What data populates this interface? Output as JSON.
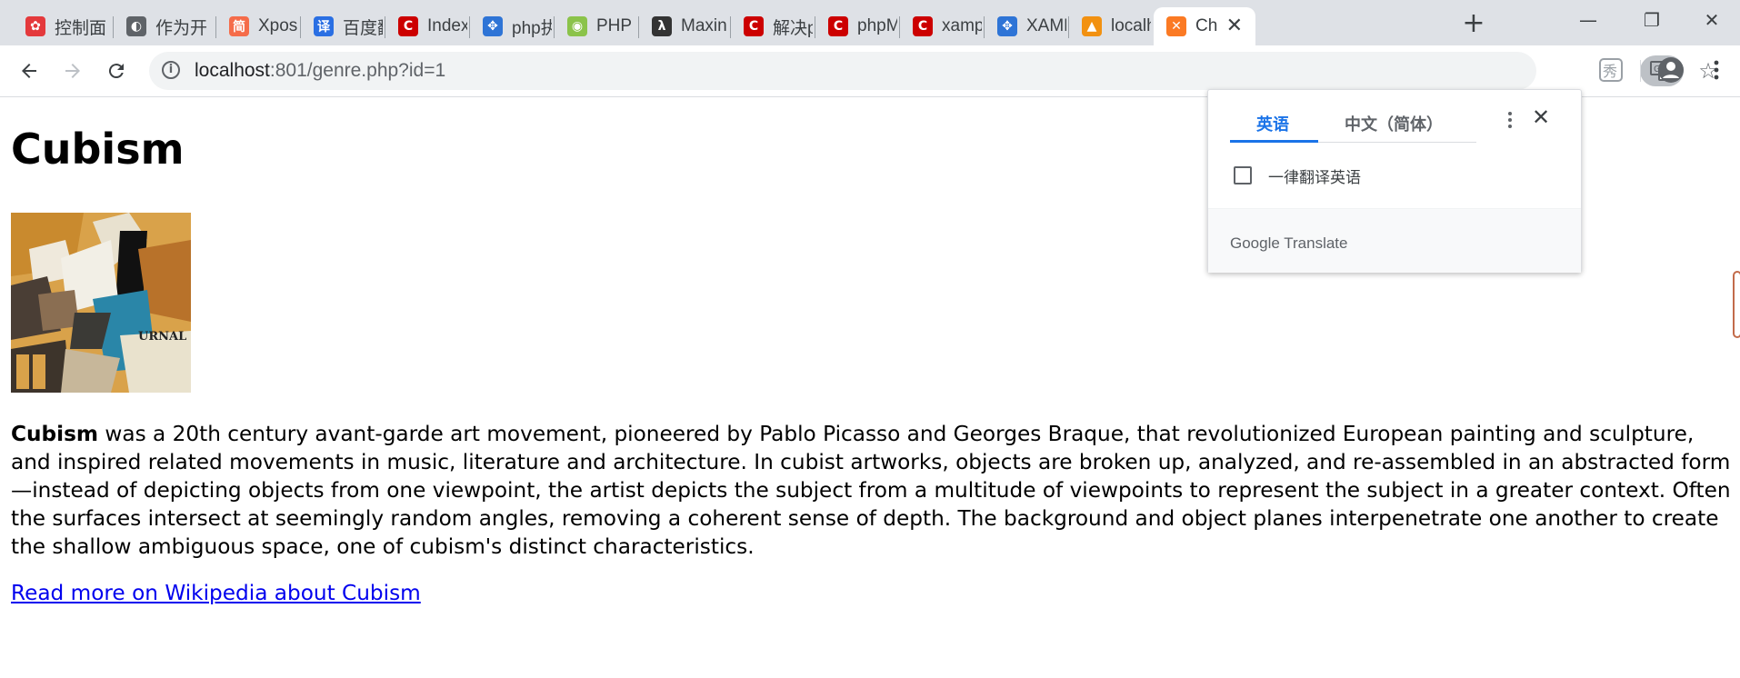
{
  "browser": {
    "tabs": [
      {
        "title": "控制面",
        "favicon": "huawei-icon",
        "color": "#e4393c"
      },
      {
        "title": "作为开",
        "favicon": "globe-icon",
        "color": "#5f6368"
      },
      {
        "title": "Xpose",
        "favicon": "jian-icon",
        "color": "#f56c4a"
      },
      {
        "title": "百度翻",
        "favicon": "translate-yi-icon",
        "color": "#2a6fe3"
      },
      {
        "title": "Index",
        "favicon": "csdn-icon",
        "color": "#c00"
      },
      {
        "title": "php执",
        "favicon": "baidu-paw-icon",
        "color": "#2e74d6"
      },
      {
        "title": "PHP $",
        "favicon": "php-icon",
        "color": "#8bc34a"
      },
      {
        "title": "Maxin",
        "favicon": "maxin-icon",
        "color": "#333"
      },
      {
        "title": "解决pl",
        "favicon": "csdn-icon",
        "color": "#c00"
      },
      {
        "title": "phpM",
        "favicon": "csdn-icon",
        "color": "#c00"
      },
      {
        "title": "xampp",
        "favicon": "csdn-icon",
        "color": "#c00"
      },
      {
        "title": "XAMP",
        "favicon": "baidu-paw-icon",
        "color": "#2e74d6"
      },
      {
        "title": "localh",
        "favicon": "phpmyadmin-icon",
        "color": "#f29111"
      },
      {
        "title": "Ch",
        "favicon": "xampp-icon",
        "color": "#fb7a24",
        "active": true
      }
    ],
    "new_tab_label": "+",
    "address": {
      "host": "localhost",
      "rest": ":801/genre.php?id=1"
    }
  },
  "page": {
    "heading": "Cubism",
    "lead_term": "Cubism",
    "description": " was a 20th century avant-garde art movement, pioneered by Pablo Picasso and Georges Braque, that revolutionized European painting and sculpture, and inspired related movements in music, literature and architecture. In cubist artworks, objects are broken up, analyzed, and re-assembled in an abstracted form—instead of depicting objects from one viewpoint, the artist depicts the subject from a multitude of viewpoints to represent the subject in a greater context. Often the surfaces intersect at seemingly random angles, removing a coherent sense of depth. The background and object planes interpenetrate one another to create the shallow ambiguous space, one of cubism's distinct characteristics.",
    "link_text": "Read more on Wikipedia about Cubism",
    "image_text": "URNAL"
  },
  "translate_popup": {
    "tab_source": "英语",
    "tab_target": "中文（简体）",
    "checkbox_label": "一律翻译英语",
    "brand_google": "Google",
    "brand_translate": "Translate"
  },
  "colors": {
    "accent": "#1a73e8",
    "link": "#0000ee"
  }
}
